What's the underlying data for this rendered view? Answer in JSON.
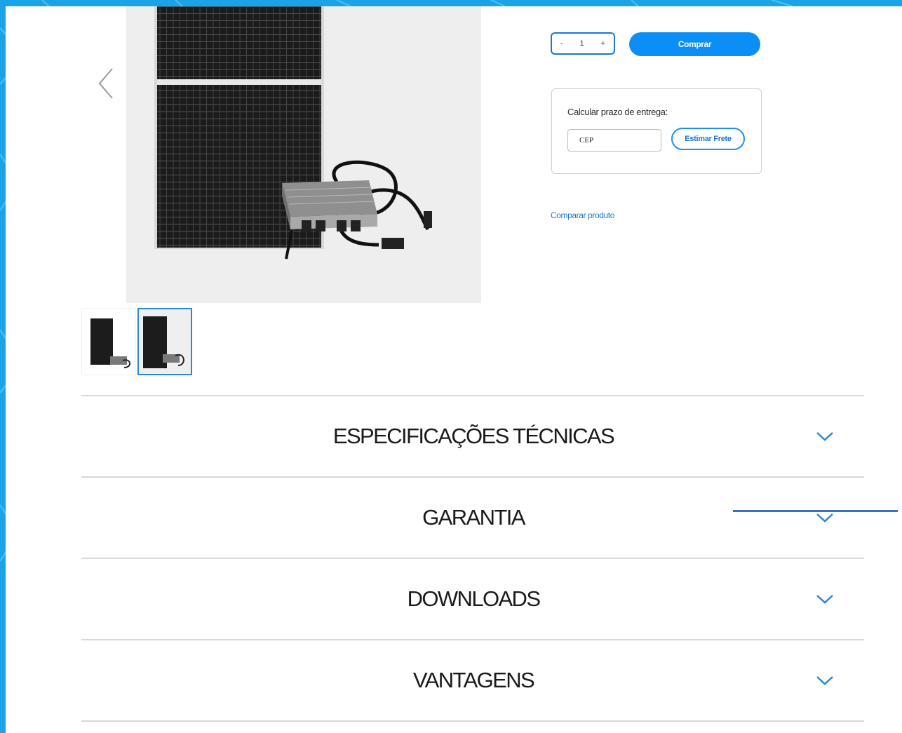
{
  "product": {
    "image_alt": "Kit micro inversor com painel solar",
    "quantity": "1",
    "qty_minus": "-",
    "qty_plus": "+",
    "buy_label": "Comprar"
  },
  "shipping": {
    "label": "Calcular prazo de entrega:",
    "cep_placeholder": "CEP",
    "estimate_label": "Estimar Frete"
  },
  "compare_label": "Comparar produto",
  "accordion": {
    "items": [
      {
        "title": "ESPECIFICAÇÕES TÉCNICAS"
      },
      {
        "title": "GARANTIA"
      },
      {
        "title": "DOWNLOADS"
      },
      {
        "title": "VANTAGENS"
      }
    ]
  },
  "colors": {
    "accent": "#0b8ef5",
    "link": "#1e77cf",
    "frame": "#1aa3e8"
  },
  "icons": [
    "chevron-left-icon",
    "chevron-down-icon"
  ]
}
